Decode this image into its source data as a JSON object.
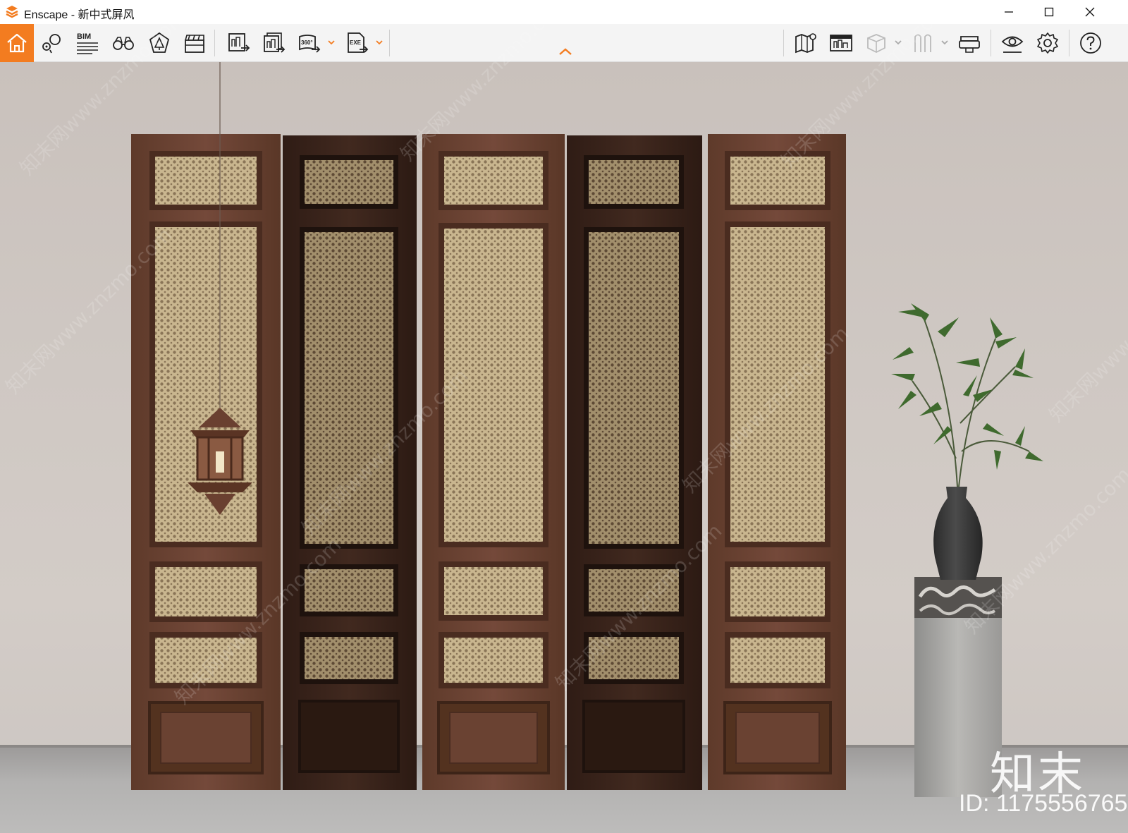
{
  "window": {
    "app_name": "Enscape",
    "title": "Enscape - 新中式屏风"
  },
  "toolbar": {
    "left_buttons": [
      {
        "name": "home-icon",
        "label": ""
      },
      {
        "name": "views-icon",
        "label": ""
      },
      {
        "name": "bim-icon",
        "label": "BIM"
      },
      {
        "name": "binoculars-icon",
        "label": ""
      },
      {
        "name": "asset-library-icon",
        "label": ""
      },
      {
        "name": "video-editor-icon",
        "label": ""
      },
      {
        "name": "screenshot-icon",
        "label": ""
      },
      {
        "name": "batch-render-icon",
        "label": ""
      },
      {
        "name": "panorama-360-icon",
        "label": "360°"
      },
      {
        "name": "export-exe-icon",
        "label": "EXE"
      }
    ],
    "right_buttons": [
      {
        "name": "map-icon"
      },
      {
        "name": "live-sync-icon"
      },
      {
        "name": "cube-icon"
      },
      {
        "name": "xray-icon"
      },
      {
        "name": "vr-headset-icon"
      },
      {
        "name": "visual-settings-icon"
      },
      {
        "name": "settings-gear-icon"
      },
      {
        "name": "help-icon"
      }
    ],
    "accent_color": "#f37c20"
  },
  "watermark": {
    "logo_text": "知末",
    "id_text": "ID: 1175556765",
    "site_text": "知末网www.znzmo.com"
  },
  "scene": {
    "wall_color": "#cdc6c1",
    "floor_color": "#b4b3b2",
    "panel_dark": "#4a2e22",
    "panel_light": "#6b4232",
    "cane_color": "#c8b48c"
  }
}
